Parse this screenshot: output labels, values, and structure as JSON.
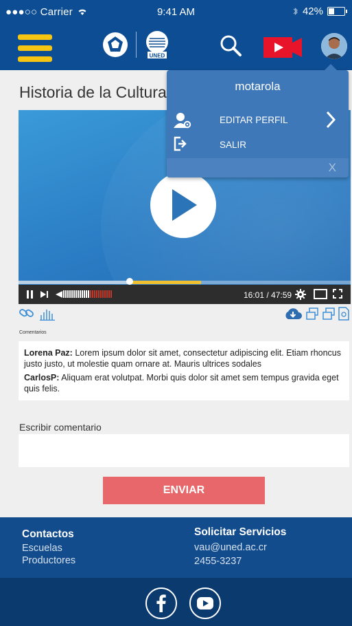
{
  "status_bar": {
    "carrier": "●●●○○ Carrier",
    "time": "9:41 AM",
    "battery": "42%",
    "battery_level": 0.42
  },
  "header": {
    "logo_text": "UNED"
  },
  "page": {
    "title": "Historia de la Cultura"
  },
  "player": {
    "timecode": "16:01 / 47:59",
    "progress": 0.335,
    "buffered": 0.55
  },
  "comments": {
    "label": "Comentarios",
    "items": [
      {
        "author": "Lorena Paz:",
        "text": " Lorem ipsum dolor sit amet, consectetur adipiscing elit. Etiam rhoncus justo justo, ut molestie quam ornare at. Mauris ultrices sodales"
      },
      {
        "author": "CarlosP:",
        "text": "  Aliquam erat volutpat. Morbi quis dolor sit amet sem tempus gravida eget quis felis."
      }
    ]
  },
  "compose": {
    "label": "Escribir comentario",
    "value": "",
    "send_label": "ENVIAR"
  },
  "footer": {
    "contacts_title": "Contactos",
    "contacts_items": [
      "Escuelas",
      "Productores"
    ],
    "services_title": "Solicitar Servicios",
    "email": "vau@uned.ac.cr",
    "phone": "2455-3237"
  },
  "user_menu": {
    "username": "motarola",
    "items": [
      {
        "label": "EDITAR PERFIL",
        "icon": "user-settings-icon"
      },
      {
        "label": "SALIR",
        "icon": "logout-icon"
      }
    ],
    "close_label": "X"
  },
  "colors": {
    "header_bg": "#0d4d93",
    "menu_accent": "#f5c512",
    "send_bg": "#e8676a",
    "footer_bg": "#134c8c",
    "video_record": "#e8152a"
  }
}
